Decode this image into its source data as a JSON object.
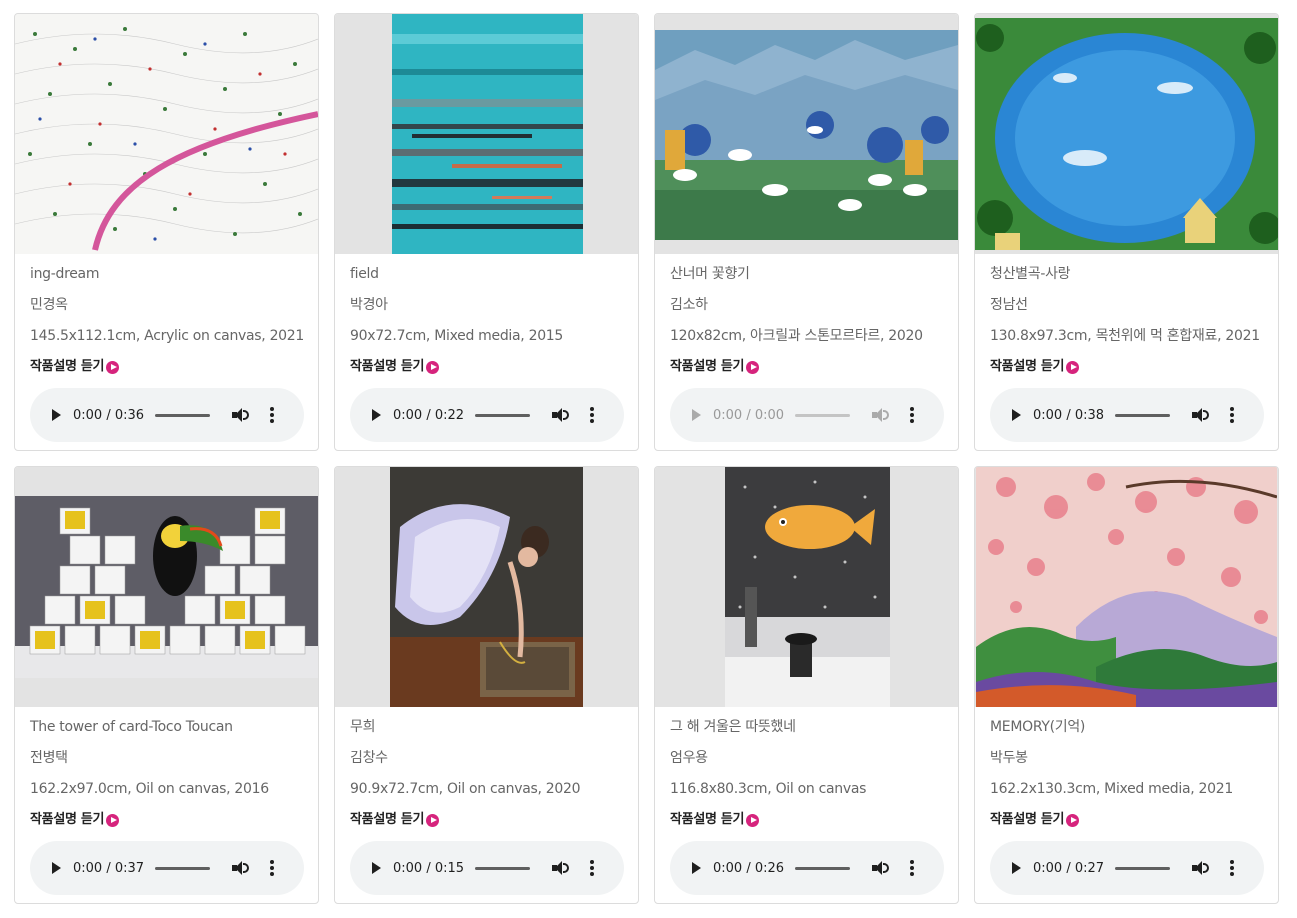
{
  "artworks": [
    {
      "title": "ing-dream",
      "artist": "민경옥",
      "meta": "145.5x112.1cm, Acrylic on canvas, 2021",
      "listen": "작품설명 듣기",
      "time": "0:00 / 0:36",
      "disabled": false
    },
    {
      "title": "field",
      "artist": "박경아",
      "meta": "90x72.7cm, Mixed media, 2015",
      "listen": "작품설명 듣기",
      "time": "0:00 / 0:22",
      "disabled": false
    },
    {
      "title": "산너머 꽃향기",
      "artist": "김소하",
      "meta": "120x82cm, 아크릴과 스톤모르타르, 2020",
      "listen": "작품설명 듣기",
      "time": "0:00 / 0:00",
      "disabled": true
    },
    {
      "title": "청산별곡-사랑",
      "artist": "정남선",
      "meta": "130.8x97.3cm, 목천위에 먹 혼합재료, 2021",
      "listen": "작품설명 듣기",
      "time": "0:00 / 0:38",
      "disabled": false
    },
    {
      "title": "The tower of card-Toco Toucan",
      "artist": "전병택",
      "meta": "162.2x97.0cm, Oil on canvas, 2016",
      "listen": "작품설명 듣기",
      "time": "0:00 / 0:37",
      "disabled": false
    },
    {
      "title": "무희",
      "artist": "김창수",
      "meta": "90.9x72.7cm, Oil on canvas, 2020",
      "listen": "작품설명 듣기",
      "time": "0:00 / 0:15",
      "disabled": false
    },
    {
      "title": "그 해 겨울은 따뜻했네",
      "artist": "엄우용",
      "meta": "116.8x80.3cm, Oil on canvas",
      "listen": "작품설명 듣기",
      "time": "0:00 / 0:26",
      "disabled": false
    },
    {
      "title": "MEMORY(기억)",
      "artist": "박두봉",
      "meta": "162.2x130.3cm, Mixed media, 2021",
      "listen": "작품설명 듣기",
      "time": "0:00 / 0:27",
      "disabled": false
    }
  ],
  "icons": {
    "listen": "play-circle-icon",
    "player_play": "play-icon",
    "player_volume": "volume-icon",
    "player_more": "more-vert-icon"
  },
  "colors": {
    "accent": "#d6247d",
    "player_bg": "#f1f3f4"
  }
}
